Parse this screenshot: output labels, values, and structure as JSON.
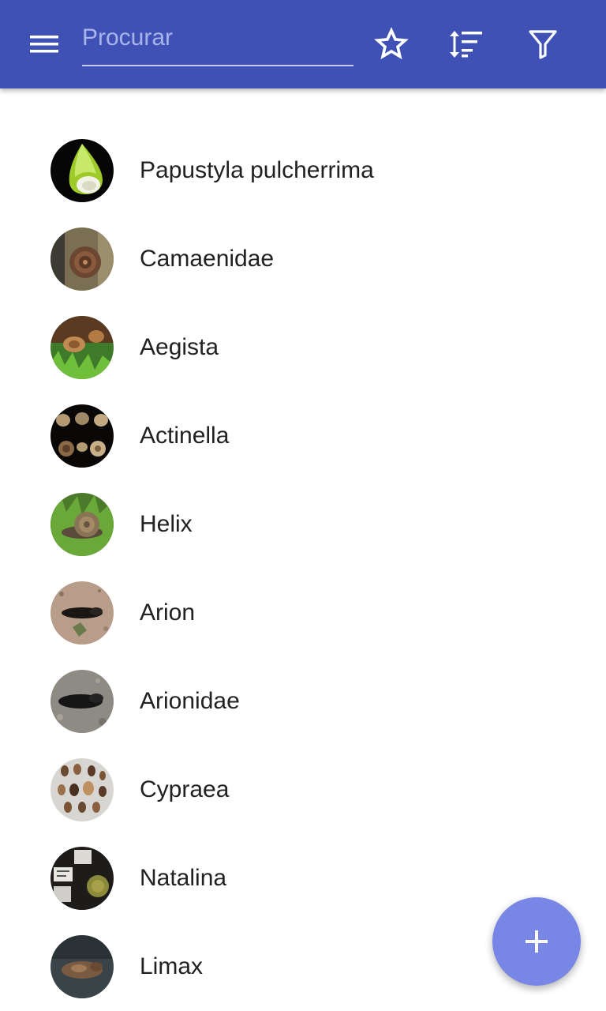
{
  "toolbar": {
    "background": "#3f51b5",
    "menu_icon": "menu-icon",
    "search": {
      "placeholder": "Procurar",
      "value": ""
    },
    "actions": [
      {
        "name": "favorites",
        "icon": "star-outline-icon"
      },
      {
        "name": "sort",
        "icon": "sort-icon"
      },
      {
        "name": "filter",
        "icon": "filter-icon"
      }
    ]
  },
  "species": {
    "items": [
      {
        "label": "Papustyla pulcherrima"
      },
      {
        "label": "Camaenidae"
      },
      {
        "label": "Aegista"
      },
      {
        "label": "Actinella"
      },
      {
        "label": "Helix"
      },
      {
        "label": "Arion"
      },
      {
        "label": "Arionidae"
      },
      {
        "label": "Cypraea"
      },
      {
        "label": "Natalina"
      },
      {
        "label": "Limax"
      }
    ]
  },
  "fab": {
    "icon": "plus-icon",
    "color": "#7986e6"
  }
}
